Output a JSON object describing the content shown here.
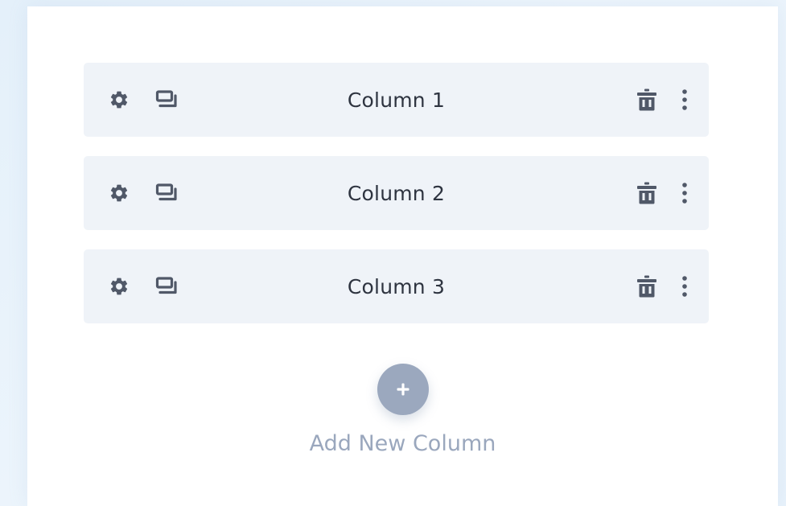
{
  "columns": [
    {
      "label": "Column 1",
      "icons": [
        "gear-icon",
        "duplicate-icon",
        "trash-icon",
        "more-vertical-icon"
      ]
    },
    {
      "label": "Column 2",
      "icons": [
        "gear-icon",
        "duplicate-icon",
        "trash-icon",
        "more-vertical-icon"
      ]
    },
    {
      "label": "Column 3",
      "icons": [
        "gear-icon",
        "duplicate-icon",
        "trash-icon",
        "more-vertical-icon"
      ]
    }
  ],
  "add_column": {
    "label": "Add New Column",
    "icon": "plus-icon"
  },
  "colors": {
    "row_background": "#eff3f8",
    "icon": "#505868",
    "title_text": "#2e3440",
    "add_button": "#9ba8be",
    "add_label": "#9aa7bd"
  }
}
